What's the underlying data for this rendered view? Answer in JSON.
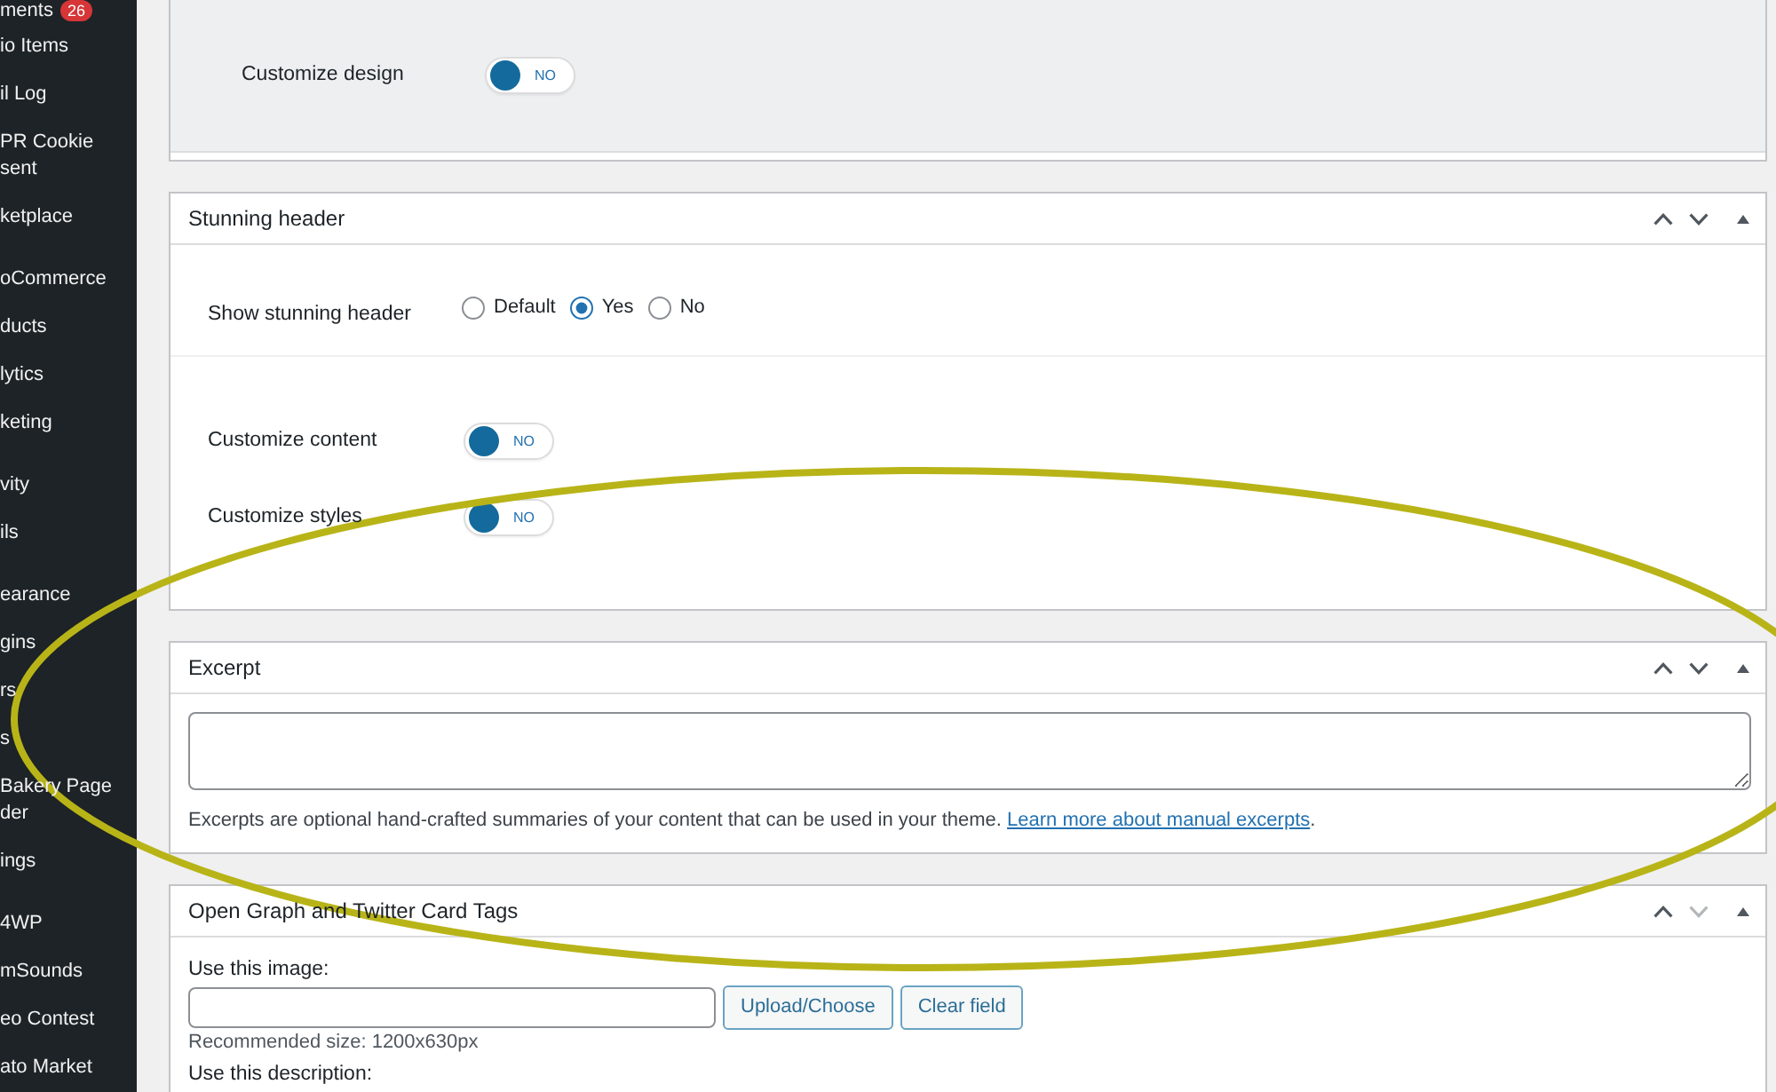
{
  "sidebar": {
    "groups": [
      [
        {
          "label": "ments",
          "badge": "26"
        },
        {
          "label": "io Items"
        },
        {
          "label": "il Log"
        },
        {
          "label": "PR Cookie sent"
        },
        {
          "label": "ketplace"
        }
      ],
      [
        {
          "label": "oCommerce"
        },
        {
          "label": "ducts"
        },
        {
          "label": "lytics"
        },
        {
          "label": "keting"
        }
      ],
      [
        {
          "label": "vity"
        },
        {
          "label": "ils"
        }
      ],
      [
        {
          "label": "earance"
        },
        {
          "label": "gins"
        },
        {
          "label": "rs"
        },
        {
          "label": "s"
        },
        {
          "label": "Bakery Page der"
        },
        {
          "label": "ings"
        }
      ],
      [
        {
          "label": "4WP"
        },
        {
          "label": "mSounds"
        },
        {
          "label": "eo Contest"
        },
        {
          "label": "ato Market"
        }
      ]
    ]
  },
  "panels": [
    {
      "kind": "design",
      "toggles": [
        {
          "label": "Customize design",
          "on": false,
          "text": "NO"
        }
      ]
    },
    {
      "kind": "stunning",
      "title": "Stunning header",
      "actions": [
        {
          "kind": "up",
          "disabled": false
        },
        {
          "kind": "down",
          "disabled": false
        },
        {
          "kind": "collapse",
          "disabled": false
        }
      ],
      "radio_group": {
        "label": "Show stunning header",
        "options": [
          {
            "label": "Default",
            "selected": false
          },
          {
            "label": "Yes",
            "selected": true
          },
          {
            "label": "No",
            "selected": false
          }
        ]
      },
      "toggles": [
        {
          "label": "Customize content",
          "on": false,
          "text": "NO"
        },
        {
          "label": "Customize styles",
          "on": false,
          "text": "NO"
        }
      ]
    },
    {
      "kind": "excerpt",
      "title": "Excerpt",
      "actions": [
        {
          "kind": "up",
          "disabled": false
        },
        {
          "kind": "down",
          "disabled": false
        },
        {
          "kind": "collapse",
          "disabled": false
        }
      ],
      "help": {
        "text": "Excerpts are optional hand-crafted summaries of your content that can be used in your theme.",
        "link": "Learn more about manual excerpts",
        "end": "."
      }
    },
    {
      "kind": "og",
      "title": "Open Graph and Twitter Card Tags",
      "actions": [
        {
          "kind": "up",
          "disabled": false
        },
        {
          "kind": "down",
          "disabled": true
        },
        {
          "kind": "collapse",
          "disabled": false
        }
      ],
      "image_label": "Use this image:",
      "buttons": [
        {
          "label": "Upload/Choose"
        },
        {
          "label": "Clear field"
        }
      ],
      "image_hint": "Recommended size: 1200x630px",
      "description_label": "Use this description:"
    }
  ],
  "annotations": [
    {
      "kind": "ellipse"
    }
  ]
}
